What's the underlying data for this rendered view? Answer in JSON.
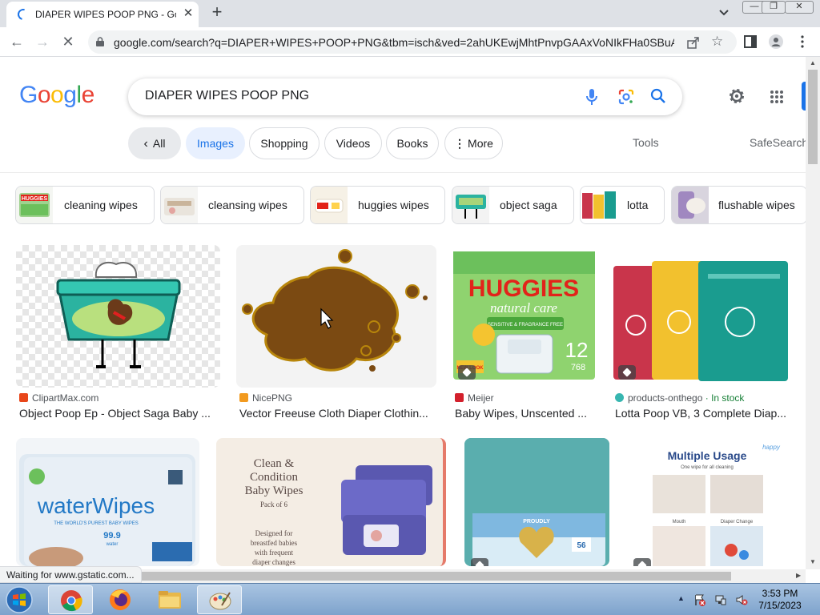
{
  "browser": {
    "tab_title": "DIAPER WIPES POOP PNG - Goo",
    "tab_close": "✕",
    "new_tab": "+",
    "url": "google.com/search?q=DIAPER+WIPES+POOP+PNG&tbm=isch&ved=2ahUKEwjMhtPnvpGAAxVoNIkFHa0SBuA...",
    "status_text": "Waiting for www.gstatic.com...",
    "icons": [
      "back-icon",
      "forward-icon",
      "stop-icon",
      "lock-icon",
      "share-icon",
      "star-icon",
      "side-panel-icon",
      "profile-icon",
      "menu-icon"
    ]
  },
  "google": {
    "logo": [
      "G",
      "o",
      "o",
      "g",
      "l",
      "e"
    ],
    "logo_colors": [
      "#4285F4",
      "#EA4335",
      "#FBBC05",
      "#4285F4",
      "#34A853",
      "#EA4335"
    ],
    "query": "DIAPER WIPES POOP PNG"
  },
  "filters": {
    "all": "All",
    "images": "Images",
    "shopping": "Shopping",
    "videos": "Videos",
    "books": "Books",
    "more": "More",
    "tools": "Tools",
    "safesearch": "SafeSearch"
  },
  "related": [
    {
      "label": "cleaning wipes"
    },
    {
      "label": "cleansing wipes"
    },
    {
      "label": "huggies wipes"
    },
    {
      "label": "object saga"
    },
    {
      "label": "lotta"
    },
    {
      "label": "flushable wipes"
    }
  ],
  "results": [
    {
      "source": "ClipartMax.com",
      "title": "Object Poop Ep - Object Saga Baby ...",
      "fav_color": "#e8461a"
    },
    {
      "source": "NicePNG",
      "title": "Vector Freeuse Cloth Diaper Clothin...",
      "fav_color": "#f29a1f"
    },
    {
      "source": "Meijer",
      "title": "Baby Wipes, Unscented ...",
      "fav_color": "#d3202c",
      "image_text": {
        "brand": "HUGGIES",
        "line": "natural care",
        "sub": "SENSITIVE & FRAGRANCE FREE",
        "count": "12",
        "count_label": "768",
        "badge": "NEW LOOK"
      }
    },
    {
      "source": "products-onthego",
      "stock": "· In stock",
      "title": "Lotta Poop VB, 3 Complete Diap...",
      "fav_color": "#37b6b0"
    },
    {
      "image_text": {
        "brand": "waterWipes",
        "tagline": "THE WORLD'S PUREST BABY WIPES",
        "pct": "99.9",
        "pct_label": "water"
      }
    },
    {
      "image_text": {
        "line1": "Clean &",
        "line2": "Condition",
        "line3": "Baby Wipes",
        "pack": "Pack of 6",
        "desc1": "Designed for",
        "desc2": "breastfed babies",
        "desc3": "with frequent",
        "desc4": "diaper changes"
      }
    },
    {
      "image_text": {
        "brand": "PROUDLY",
        "count": "56"
      }
    },
    {
      "image_text": {
        "title": "Multiple Usage",
        "subtitle": "One wipe for all cleaning",
        "cap1": "Mouth",
        "cap2": "Diaper Change",
        "brand": "happy"
      }
    }
  ],
  "taskbar": {
    "time": "3:53 PM",
    "date": "7/15/2023"
  },
  "colors": {
    "accent": "#1a73e8",
    "chip_selected_bg": "#e8f0fe",
    "in_stock": "#188038"
  }
}
